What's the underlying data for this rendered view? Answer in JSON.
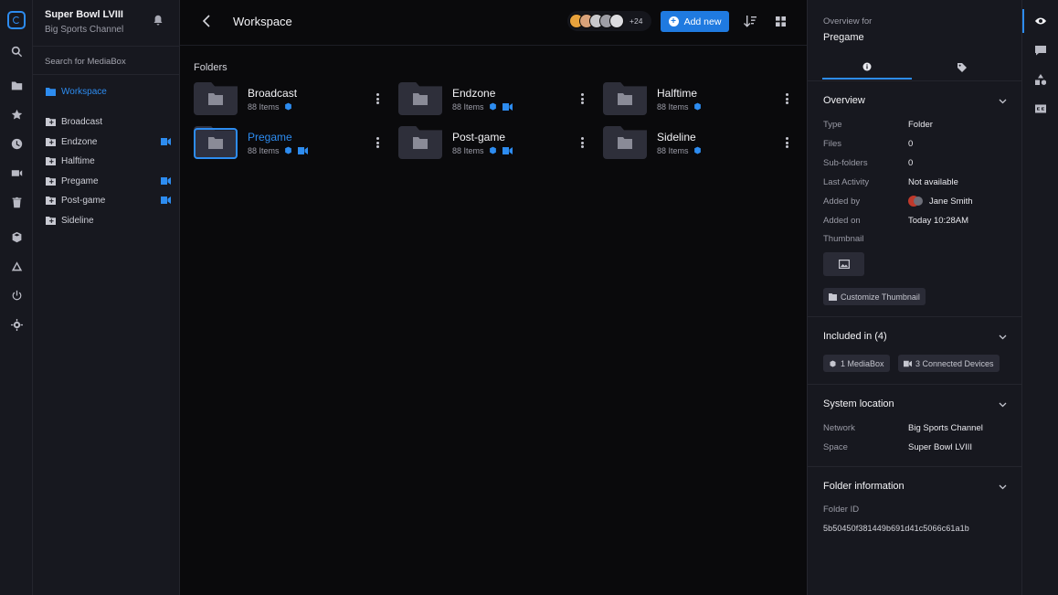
{
  "sidebar": {
    "workspace_name": "Super Bowl LVIII",
    "workspace_channel": "Big Sports Channel",
    "search_placeholder": "Search for MediaBox",
    "root_label": "Workspace",
    "items": [
      {
        "label": "Broadcast",
        "camera": false
      },
      {
        "label": "Endzone",
        "camera": true
      },
      {
        "label": "Halftime",
        "camera": false
      },
      {
        "label": "Pregame",
        "camera": true
      },
      {
        "label": "Post-game",
        "camera": true
      },
      {
        "label": "Sideline",
        "camera": false
      }
    ]
  },
  "header": {
    "title": "Workspace",
    "avatars_more": "+24",
    "add_new_label": "Add new"
  },
  "main": {
    "section_title": "Folders",
    "folders": [
      {
        "name": "Broadcast",
        "items": "88 Items",
        "camera": false,
        "selected": false
      },
      {
        "name": "Endzone",
        "items": "88 Items",
        "camera": true,
        "selected": false
      },
      {
        "name": "Halftime",
        "items": "88 Items",
        "camera": true,
        "selected": false
      },
      {
        "name": "Pregame",
        "items": "88 Items",
        "camera": true,
        "selected": true
      },
      {
        "name": "Post-game",
        "items": "88 Items",
        "camera": true,
        "selected": false
      },
      {
        "name": "Sideline",
        "items": "88 Items",
        "camera": false,
        "selected": false
      }
    ]
  },
  "details": {
    "overview_for": "Overview for",
    "name": "Pregame",
    "overview": {
      "title": "Overview",
      "rows": [
        {
          "key": "Type",
          "value": "Folder"
        },
        {
          "key": "Files",
          "value": "0"
        },
        {
          "key": "Sub-folders",
          "value": "0"
        },
        {
          "key": "Last Activity",
          "value": "Not available"
        },
        {
          "key": "Added by",
          "value": "Jane Smith"
        },
        {
          "key": "Added on",
          "value": "Today 10:28AM"
        }
      ],
      "thumbnail_label": "Thumbnail",
      "customize_label": "Customize Thumbnail"
    },
    "included": {
      "title": "Included in (4)",
      "chips": [
        "1 MediaBox",
        "3 Connected Devices"
      ]
    },
    "system": {
      "title": "System location",
      "rows": [
        {
          "key": "Network",
          "value": "Big Sports Channel"
        },
        {
          "key": "Space",
          "value": "Super Bowl LVIII"
        }
      ]
    },
    "folder_info": {
      "title": "Folder information",
      "id_label": "Folder ID",
      "id_value": "5b50450f381449b691d41c5066c61a1b"
    }
  },
  "colors": {
    "accent": "#2d8cf0",
    "add_button": "#1f7ae0",
    "panel": "#17181f",
    "main_bg": "#0a0a0c"
  }
}
